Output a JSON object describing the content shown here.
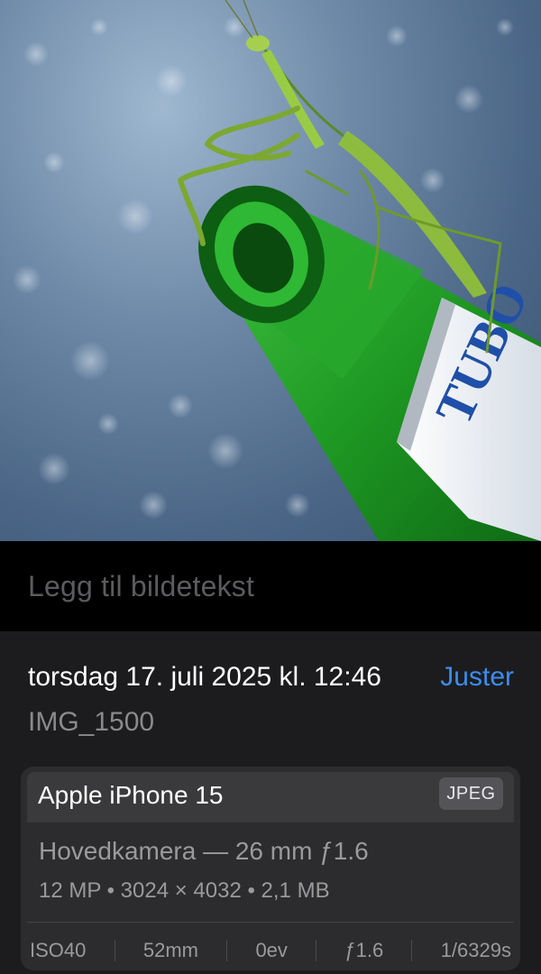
{
  "photo": {
    "label_text": "TUBO"
  },
  "caption": {
    "placeholder": "Legg til bildetekst"
  },
  "info": {
    "date": "torsdag 17. juli 2025 kl. 12:46",
    "adjust_label": "Juster",
    "filename": "IMG_1500"
  },
  "meta": {
    "device": "Apple iPhone 15",
    "format": "JPEG",
    "lens": "Hovedkamera — 26 mm ƒ1.6",
    "specs": "12 MP  •  3024 × 4032  •  2,1 MB",
    "exif": {
      "iso": "ISO40",
      "focal": "52mm",
      "ev": "0ev",
      "aperture": "ƒ1.6",
      "shutter": "1/6329s"
    }
  },
  "colors": {
    "accent": "#3a8df0",
    "panel": "#1c1c1e",
    "card": "#2c2c2e"
  }
}
